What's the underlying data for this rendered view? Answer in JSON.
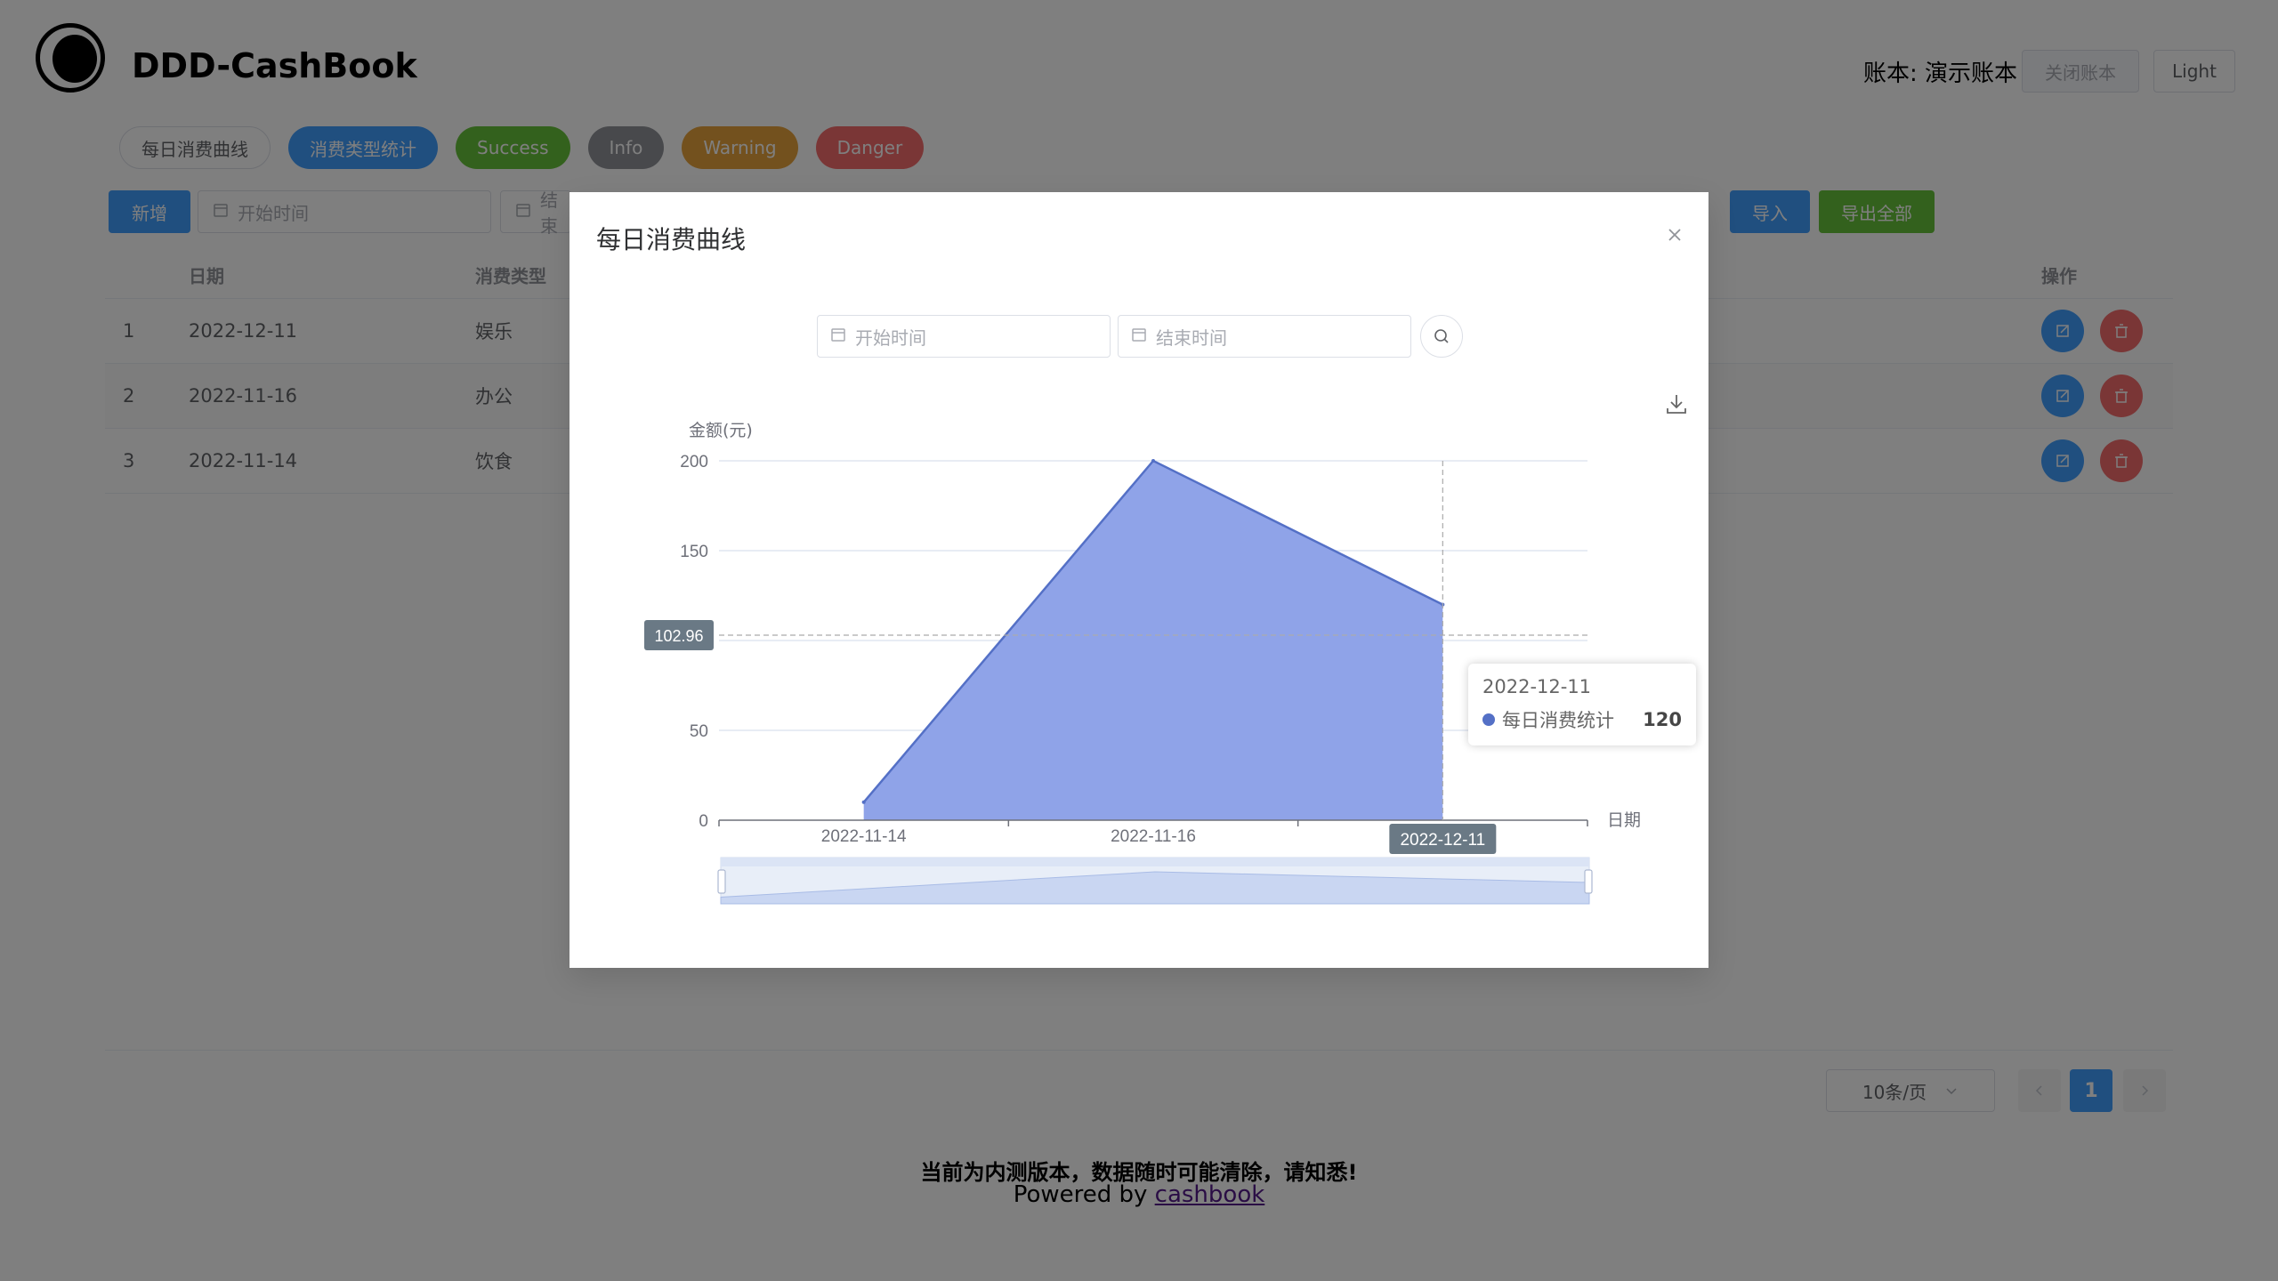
{
  "app": {
    "title": "DDD-CashBook",
    "book_label": "账本: 演示账本",
    "close_book": "关闭账本",
    "theme": "Light"
  },
  "tags": [
    "每日消费曲线",
    "消费类型统计",
    "Success",
    "Info",
    "Warning",
    "Danger"
  ],
  "toolbar": {
    "add": "新增",
    "start_placeholder": "开始时间",
    "end_placeholder_partial": "结束",
    "import": "导入",
    "export_all": "导出全部"
  },
  "table": {
    "headers": {
      "date": "日期",
      "type": "消费类型",
      "actions": "操作"
    },
    "rows": [
      {
        "idx": "1",
        "date": "2022-12-11",
        "type": "娱乐"
      },
      {
        "idx": "2",
        "date": "2022-11-16",
        "type": "办公"
      },
      {
        "idx": "3",
        "date": "2022-11-14",
        "type": "饮食"
      }
    ]
  },
  "pagination": {
    "page_size": "10条/页",
    "current": "1"
  },
  "footer": {
    "notice": "当前为内测版本，数据随时可能清除，请知悉!",
    "powered_prefix": "Powered by ",
    "powered_link": "cashbook"
  },
  "dialog": {
    "title": "每日消费曲线",
    "start_placeholder": "开始时间",
    "end_placeholder": "结束时间"
  },
  "tooltip": {
    "date": "2022-12-11",
    "series": "每日消费统计",
    "value": "120"
  },
  "chart_data": {
    "type": "area",
    "xlabel": "日期",
    "ylabel": "金额(元)",
    "x": [
      "2022-11-14",
      "2022-11-16",
      "2022-12-11"
    ],
    "series": [
      {
        "name": "每日消费统计",
        "values": [
          10,
          200,
          120
        ]
      }
    ],
    "ylim": [
      0,
      200
    ],
    "yticks": [
      0,
      50,
      100,
      150,
      200
    ],
    "yticks_labeled": [
      "0",
      "50",
      "150",
      "200"
    ],
    "crosshair_y": "102.96",
    "highlight_x": "2022-12-11",
    "color": "#5470c6",
    "fill": "#8fa3e8",
    "grid": true
  }
}
